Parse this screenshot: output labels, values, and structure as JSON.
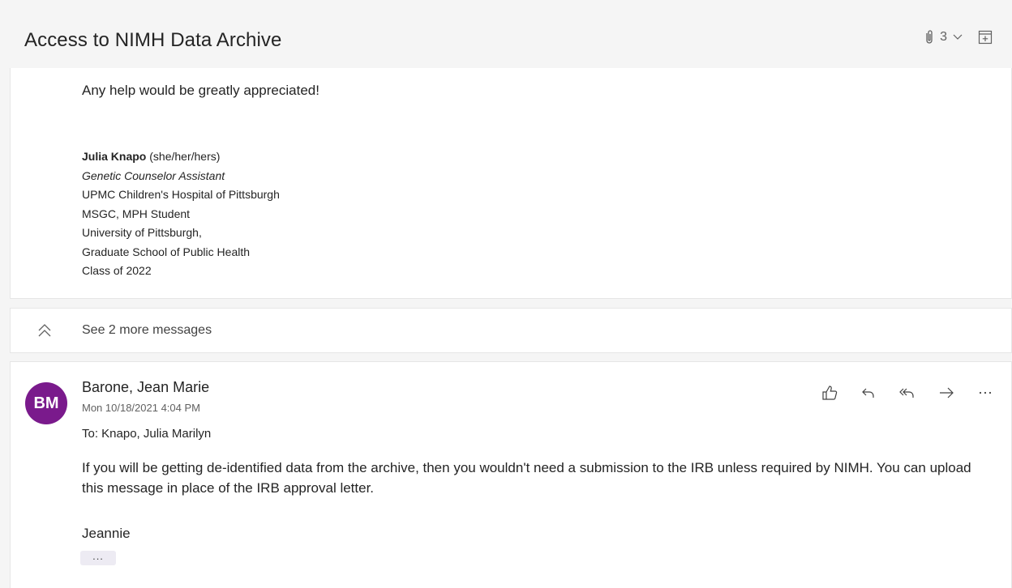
{
  "header": {
    "subject": "Access to NIMH Data Archive",
    "attachment_count": "3"
  },
  "message1": {
    "body": "Any help would be greatly appreciated!",
    "signature": {
      "name": "Julia Knapo",
      "pronouns": " (she/her/hers)",
      "title": "Genetic Counselor Assistant",
      "lines": [
        "UPMC Children's Hospital of Pittsburgh",
        "MSGC, MPH Student",
        "University of Pittsburgh,",
        "Graduate School of Public Health",
        "Class of 2022"
      ]
    }
  },
  "collapsed": {
    "label": "See 2 more messages"
  },
  "message2": {
    "avatar_initials": "BM",
    "avatar_color": "#7a1a8c",
    "sender": "Barone, Jean Marie",
    "date": "Mon 10/18/2021 4:04 PM",
    "to": "To:  Knapo, Julia Marilyn",
    "body": "If you will be getting de-identified data from the archive, then you wouldn't need a submission to the IRB unless required by NIMH. You can upload this message in place of the IRB approval letter.",
    "signoff": "Jeannie",
    "expand_label": "..."
  },
  "icons": {
    "attachment": "paperclip-icon",
    "expand": "chevron-down-icon",
    "popout": "open-in-new-window-icon",
    "collapse": "double-chevron-up-icon",
    "like": "thumbs-up-icon",
    "reply": "reply-icon",
    "reply_all": "reply-all-icon",
    "forward": "forward-icon",
    "more": "more-actions-icon"
  }
}
